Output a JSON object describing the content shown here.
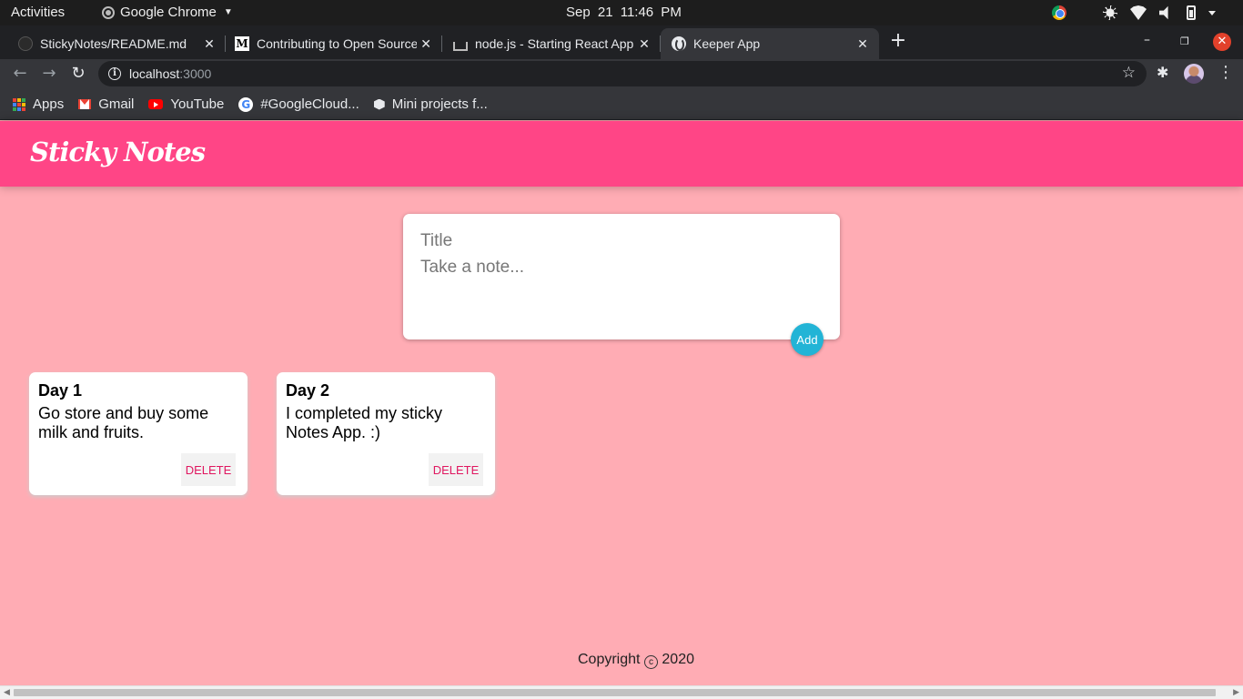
{
  "system_bar": {
    "activities": "Activities",
    "app_name": "Google Chrome",
    "clock_date": "Sep 21",
    "clock_time": "11:46 PM"
  },
  "browser": {
    "tabs": [
      {
        "title": "StickyNotes/README.md",
        "icon": "github-icon",
        "active": false
      },
      {
        "title": "Contributing to Open Source",
        "icon": "medium-icon",
        "active": false
      },
      {
        "title": "node.js - Starting React App",
        "icon": "stackoverflow-icon",
        "active": false
      },
      {
        "title": "Keeper App",
        "icon": "globe-icon",
        "active": true
      }
    ],
    "url_host": "localhost",
    "url_port": ":3000",
    "bookmarks": [
      {
        "label": "Apps",
        "icon": "apps-icon"
      },
      {
        "label": "Gmail",
        "icon": "gmail-icon"
      },
      {
        "label": "YouTube",
        "icon": "youtube-icon"
      },
      {
        "label": "#GoogleCloud...",
        "icon": "google-icon"
      },
      {
        "label": "Mini projects f...",
        "icon": "bookmark-folder-icon"
      }
    ]
  },
  "app": {
    "title": "Sticky Notes",
    "create_note": {
      "title_placeholder": "Title",
      "content_placeholder": "Take a note...",
      "add_label": "Add"
    },
    "notes": [
      {
        "title": "Day 1",
        "content": "Go store and buy some milk and fruits.",
        "delete_label": "DELETE"
      },
      {
        "title": "Day 2",
        "content": "I completed my sticky Notes App. :)",
        "delete_label": "DELETE"
      }
    ],
    "footer": {
      "prefix": "Copyright",
      "symbol": "c",
      "year": "2020"
    }
  },
  "colors": {
    "header": "#ff4586",
    "page_background": "#ffacb4",
    "add_button": "#22b4d6",
    "delete_text": "#e01760"
  }
}
